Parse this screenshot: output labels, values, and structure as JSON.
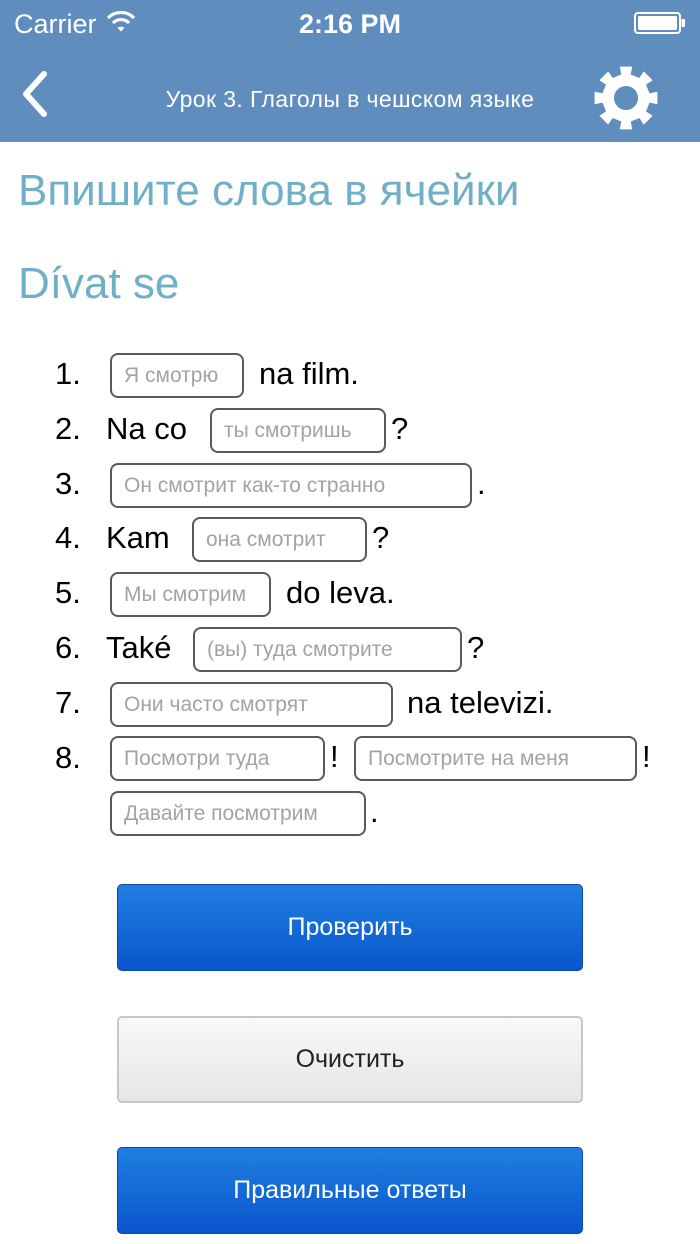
{
  "status_bar": {
    "carrier": "Carrier",
    "time": "2:16 PM"
  },
  "nav": {
    "title": "Урок 3. Глаголы в чешском языке",
    "back_icon": "chevron-left-icon",
    "settings_icon": "gear-icon"
  },
  "heading": "Впишите слова в ячейки",
  "verb": "Dívat se",
  "exercises": [
    {
      "number": "1.",
      "pre": "",
      "placeholders": [
        "Я смотрю"
      ],
      "post": "na film."
    },
    {
      "number": "2.",
      "pre": "Na co",
      "placeholders": [
        "ты смотришь"
      ],
      "post": "?"
    },
    {
      "number": "3.",
      "pre": "",
      "placeholders": [
        "Он смотрит как-то странно"
      ],
      "post": "."
    },
    {
      "number": "4.",
      "pre": "Kam",
      "placeholders": [
        "она смотрит"
      ],
      "post": "?"
    },
    {
      "number": "5.",
      "pre": "",
      "placeholders": [
        "Мы смотрим"
      ],
      "post": "do leva."
    },
    {
      "number": "6.",
      "pre": "Také",
      "placeholders": [
        "(вы) туда смотрите"
      ],
      "post": "?"
    },
    {
      "number": "7.",
      "pre": "",
      "placeholders": [
        "Они часто смотрят"
      ],
      "post": "na televizi."
    },
    {
      "number": "8.",
      "pre": "",
      "placeholders": [
        "Посмотри туда",
        "Посмотрите на меня",
        "Давайте посмотрим"
      ],
      "separators": [
        "!",
        "!",
        "."
      ]
    }
  ],
  "buttons": {
    "check": "Проверить",
    "clear": "Очистить",
    "answers": "Правильные ответы"
  },
  "colors": {
    "header": "#5f8dbd",
    "heading": "#6fb0c8",
    "button_blue": "#0a63d6"
  }
}
